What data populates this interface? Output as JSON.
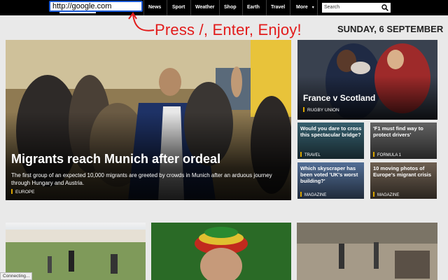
{
  "address_bar": {
    "value": "http://google.com"
  },
  "nav": {
    "items": [
      "News",
      "Sport",
      "Weather",
      "Shop",
      "Earth",
      "Travel",
      "More"
    ],
    "search_placeholder": "Search"
  },
  "annotation": "Press /, Enter, Enjoy!",
  "date": "SUNDAY, 6 SEPTEMBER",
  "hero": {
    "title": "Migrants reach Munich after ordeal",
    "description": "The first group of an expected 10,000 migrants are greeted by crowds in Munich after an arduous journey through Hungary and Austria.",
    "tag": "EUROPE"
  },
  "feature": {
    "title": "France v Scotland",
    "tag": "RUGBY UNION"
  },
  "cards": [
    {
      "title": "Would you dare to cross this spectacular bridge?",
      "tag": "TRAVEL"
    },
    {
      "title": "'F1 must find way to protect drivers'",
      "tag": "FORMULA 1"
    },
    {
      "title": "Which skyscraper has been voted 'UK's worst building?'",
      "tag": "MAGAZINE"
    },
    {
      "title": "10 moving photos of Europe's migrant crisis",
      "tag": "MAGAZINE"
    }
  ],
  "status": "Connecting..."
}
